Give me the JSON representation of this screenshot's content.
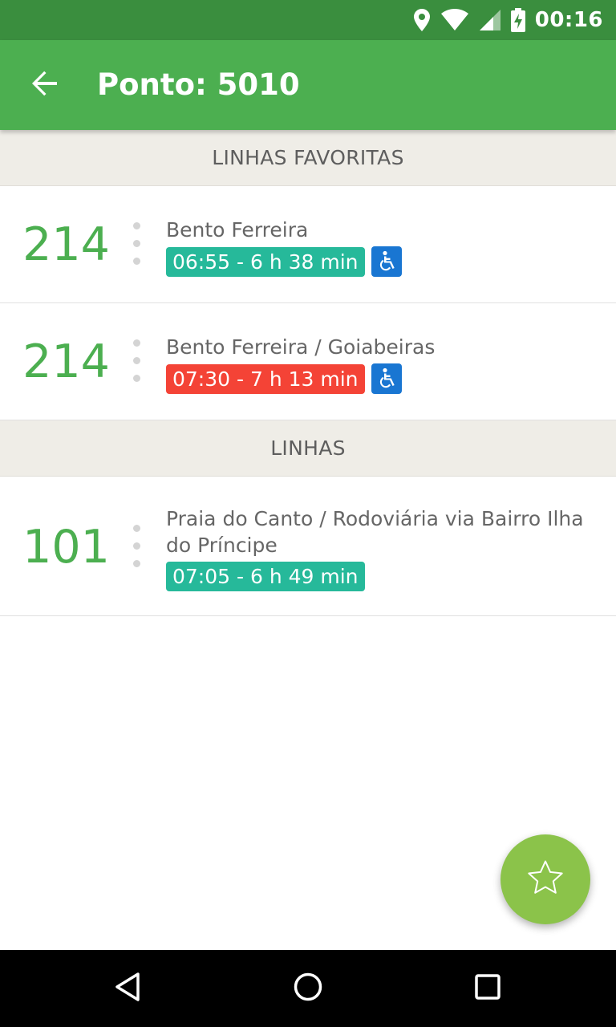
{
  "status_bar": {
    "time": "00:16",
    "icons": [
      "location-icon",
      "wifi-icon",
      "signal-icon",
      "battery-charging-icon"
    ]
  },
  "app_bar": {
    "title": "Ponto: 5010",
    "back_icon": "arrow-back-icon",
    "color": "#4caf50"
  },
  "sections": [
    {
      "header": "LINHAS FAVORITAS",
      "lines": [
        {
          "number": "214",
          "destination": "Bento Ferreira",
          "time": "06:55 - 6 h 38 min",
          "status_color": "#26b99a",
          "accessible": true
        },
        {
          "number": "214",
          "destination": "Bento Ferreira / Goiabeiras",
          "time": "07:30 - 7 h 13 min",
          "status_color": "#f44336",
          "accessible": true
        }
      ]
    },
    {
      "header": "LINHAS",
      "lines": [
        {
          "number": "101",
          "destination": "Praia do Canto / Rodoviária via Bairro Ilha do Príncipe",
          "time": "07:05 - 6 h 49 min",
          "status_color": "#26b99a",
          "accessible": false
        }
      ]
    }
  ],
  "fab": {
    "icon": "star-outline-icon",
    "color": "#8bc34a"
  },
  "nav_bar": {
    "icons": [
      "back-triangle-icon",
      "home-circle-icon",
      "recents-square-icon"
    ]
  }
}
